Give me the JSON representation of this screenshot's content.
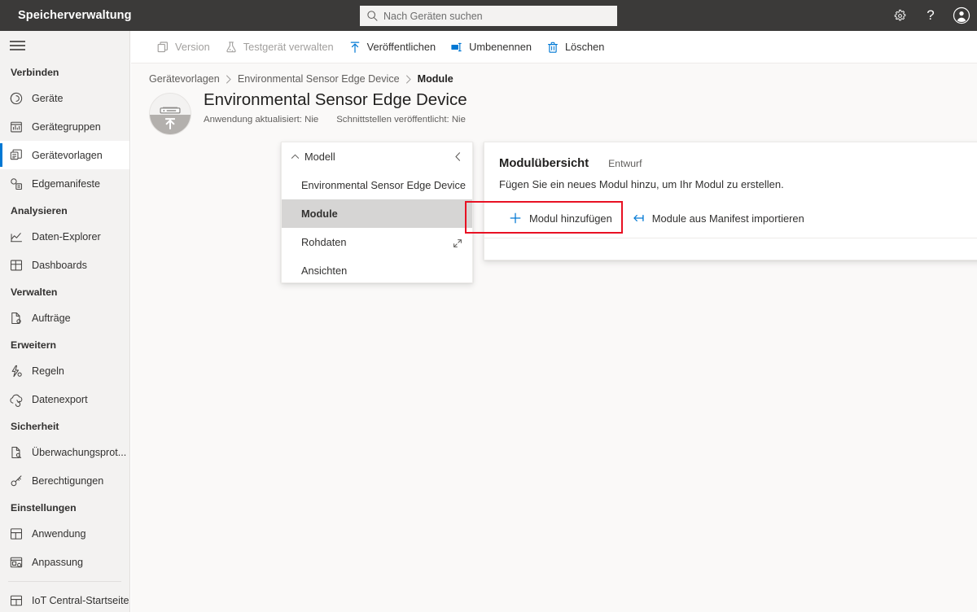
{
  "header": {
    "brand_title": "Speicherverwaltung",
    "search": {
      "placeholder": "Nach Geräten suchen",
      "icon": "search-icon"
    },
    "actions": [
      {
        "name": "settings-icon",
        "label": "Einstellungen"
      },
      {
        "name": "help-icon",
        "label": "?"
      },
      {
        "name": "account-icon",
        "label": "Konto"
      }
    ],
    "bg_color": "#3b3a39"
  },
  "sidebar": {
    "menu_icon": "hamburger-icon",
    "groups": [
      {
        "title": "Verbinden",
        "items": [
          {
            "label": "Geräte",
            "icon": "devices-icon",
            "selected": false
          },
          {
            "label": "Gerätegruppen",
            "icon": "device-groups-icon",
            "selected": false
          },
          {
            "label": "Gerätevorlagen",
            "icon": "device-templates-icon",
            "selected": true
          },
          {
            "label": "Edgemanifeste",
            "icon": "edge-manifests-icon",
            "selected": false
          }
        ]
      },
      {
        "title": "Analysieren",
        "items": [
          {
            "label": "Daten-Explorer",
            "icon": "data-explorer-icon",
            "selected": false
          },
          {
            "label": "Dashboards",
            "icon": "dashboards-icon",
            "selected": false
          }
        ]
      },
      {
        "title": "Verwalten",
        "items": [
          {
            "label": "Aufträge",
            "icon": "jobs-icon",
            "selected": false
          }
        ]
      },
      {
        "title": "Erweitern",
        "items": [
          {
            "label": "Regeln",
            "icon": "rules-icon",
            "selected": false
          },
          {
            "label": "Datenexport",
            "icon": "data-export-icon",
            "selected": false
          }
        ]
      },
      {
        "title": "Sicherheit",
        "items": [
          {
            "label": "Überwachungsprot...",
            "icon": "audit-log-icon",
            "selected": false
          },
          {
            "label": "Berechtigungen",
            "icon": "permissions-icon",
            "selected": false
          }
        ]
      },
      {
        "title": "Einstellungen",
        "items": [
          {
            "label": "Anwendung",
            "icon": "application-icon",
            "selected": false
          },
          {
            "label": "Anpassung",
            "icon": "customization-icon",
            "selected": false
          }
        ]
      }
    ],
    "footer_item": {
      "label": "IoT Central-Startseite",
      "icon": "iot-central-home-icon"
    },
    "accent_color": "#0078d4"
  },
  "command_bar": {
    "buttons": [
      {
        "label": "Version",
        "icon": "version-icon",
        "disabled": true
      },
      {
        "label": "Testgerät verwalten",
        "icon": "test-device-icon",
        "disabled": true
      },
      {
        "label": "Veröffentlichen",
        "icon": "publish-icon",
        "disabled": false
      },
      {
        "label": "Umbenennen",
        "icon": "rename-icon",
        "disabled": false
      },
      {
        "label": "Löschen",
        "icon": "delete-icon",
        "disabled": false
      }
    ]
  },
  "breadcrumb": {
    "items": [
      {
        "label": "Gerätevorlagen",
        "current": false
      },
      {
        "label": "Environmental Sensor Edge Device",
        "current": false
      },
      {
        "label": "Module",
        "current": true
      }
    ],
    "separator": "›"
  },
  "page_head": {
    "avatar_icon": "edge-gateway-device-icon",
    "title": "Environmental Sensor Edge Device",
    "meta_app_updated": "Anwendung aktualisiert: Nie",
    "meta_interfaces_published": "Schnittstellen veröffentlicht: Nie"
  },
  "model_panel": {
    "model_row": {
      "label": "Modell",
      "chevron": "chevron-up-icon",
      "collapse": "chevron-left-icon"
    },
    "rows": [
      {
        "label": "Environmental Sensor Edge Device",
        "selected": false,
        "trailing_icon": ""
      },
      {
        "label": "Module",
        "selected": true,
        "trailing_icon": ""
      },
      {
        "label": "Rohdaten",
        "selected": false,
        "trailing_icon": "open-expand-icon"
      },
      {
        "label": "Ansichten",
        "selected": false,
        "trailing_icon": ""
      }
    ]
  },
  "module_card": {
    "title": "Modulübersicht",
    "state": "Entwurf",
    "description": "Fügen Sie ein neues Modul hinzu, um Ihr Modul zu erstellen.",
    "actions": [
      {
        "label": "Modul hinzufügen",
        "icon": "plus-icon"
      },
      {
        "label": "Module aus Manifest importieren",
        "icon": "import-icon",
        "highlighted": true
      }
    ]
  },
  "highlight": {
    "color": "#e81123",
    "target": "Module aus Manifest importieren"
  }
}
